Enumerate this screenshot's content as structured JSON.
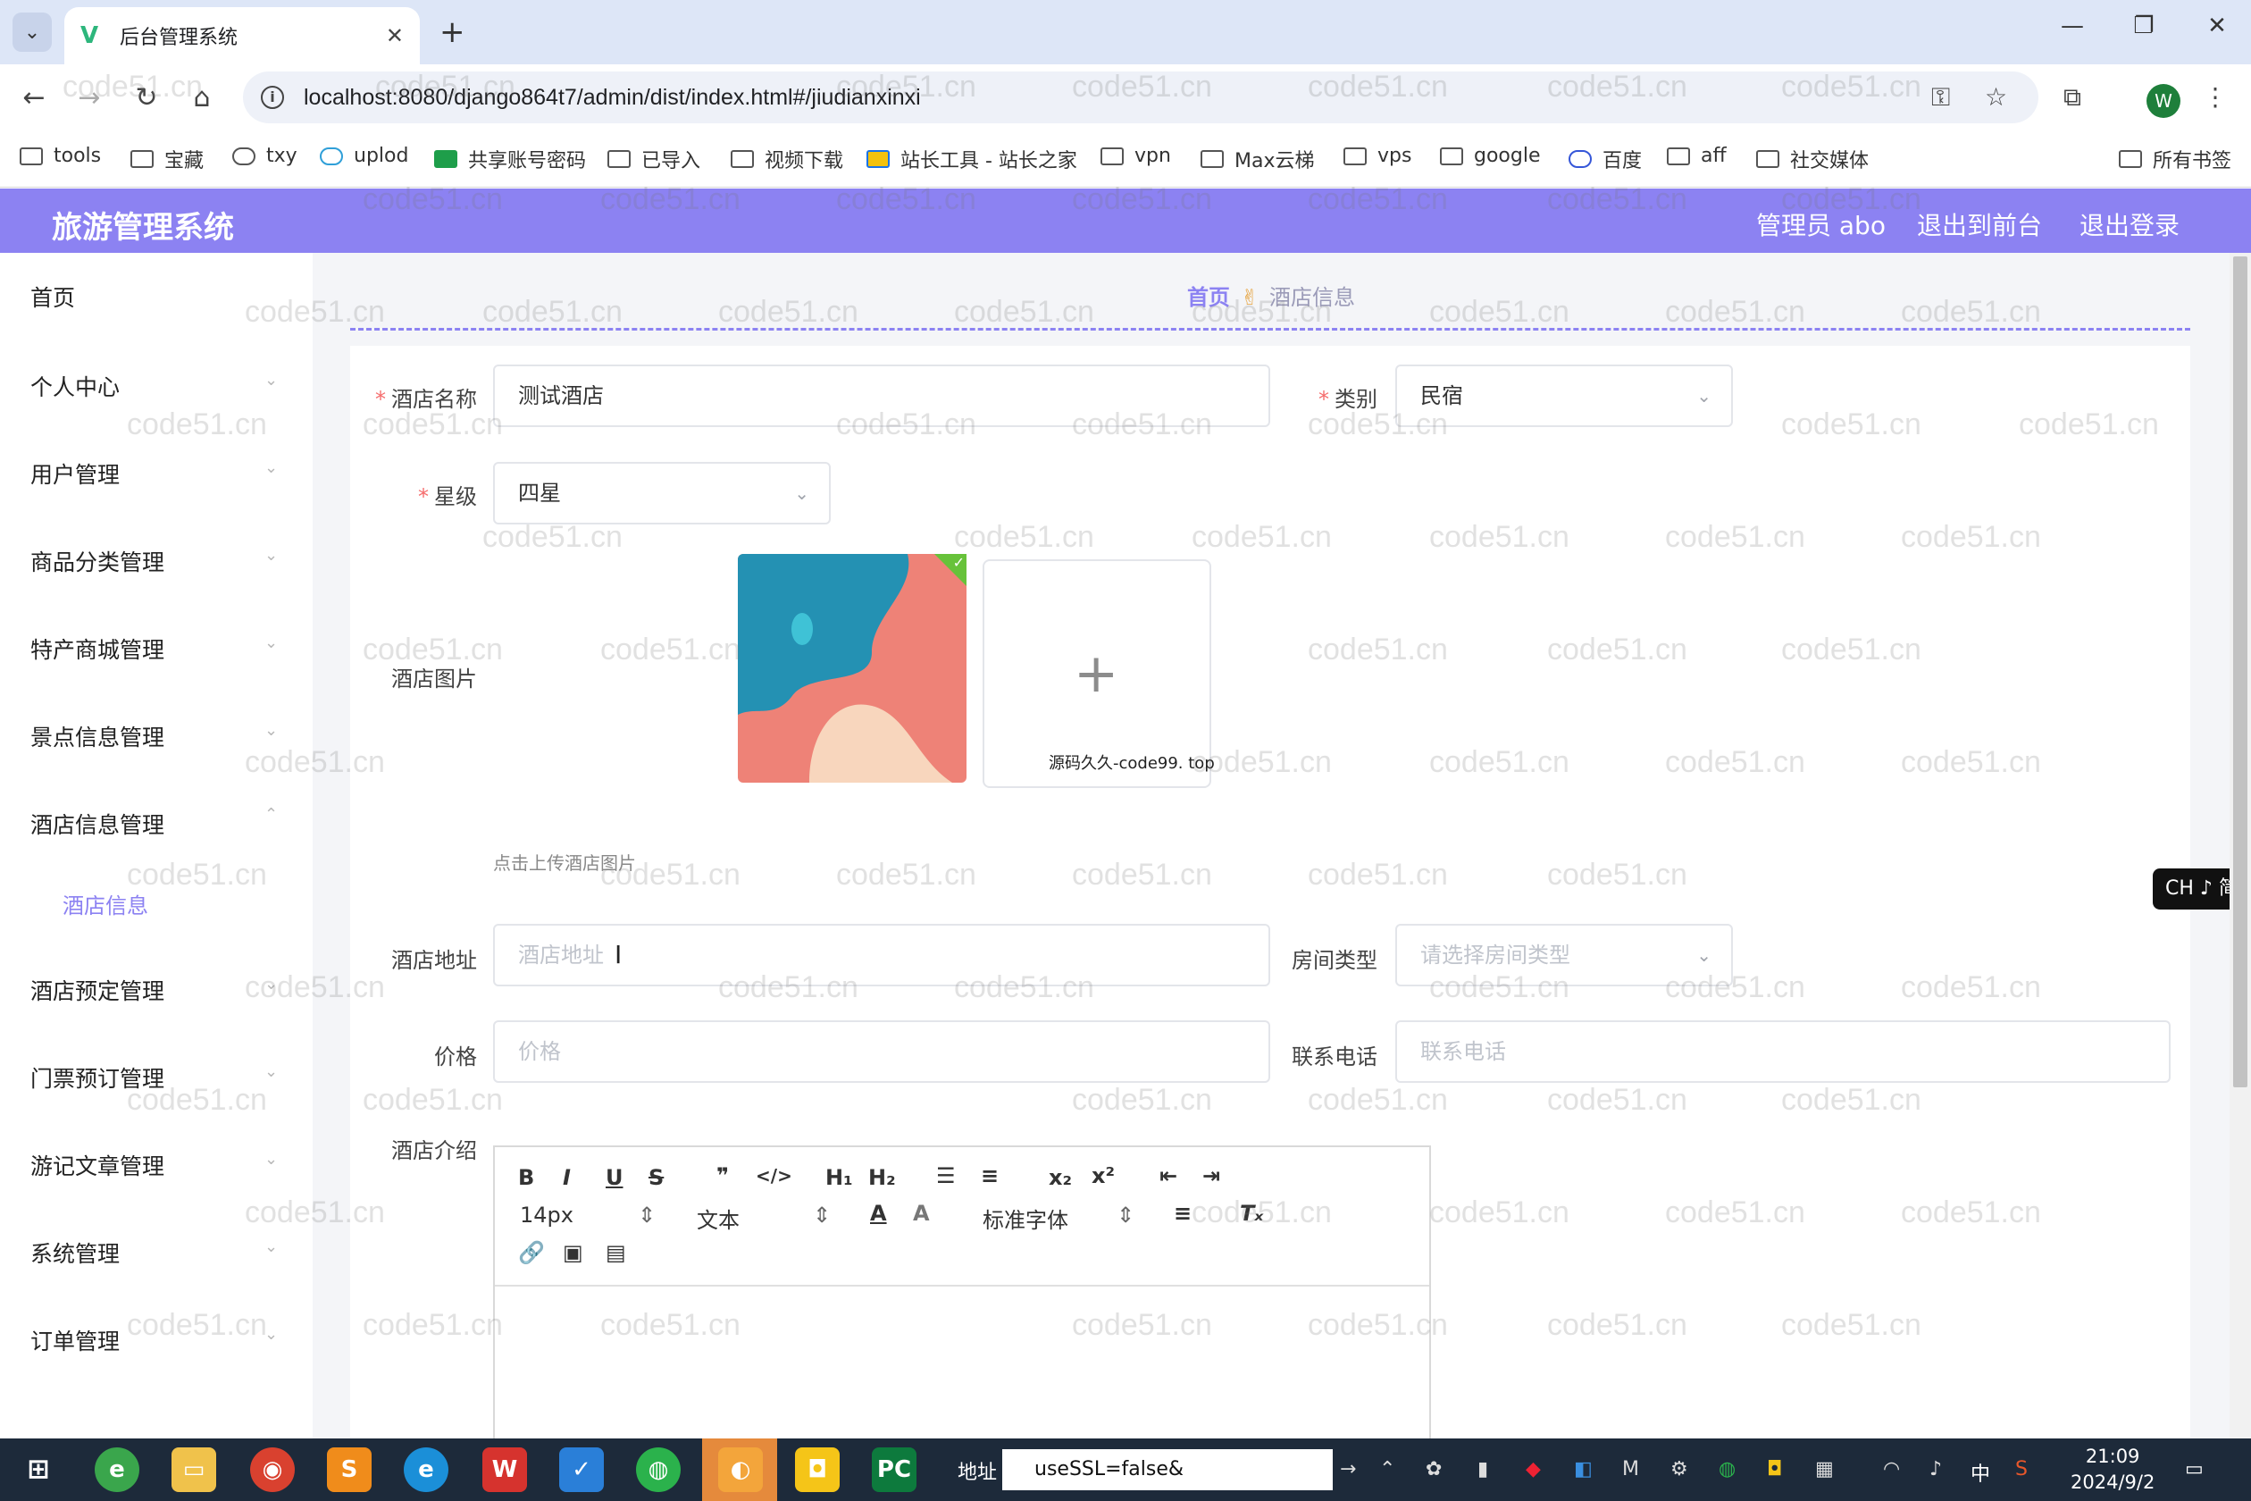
{
  "browser": {
    "tab_title": "后台管理系统",
    "url": "localhost:8080/django864t7/admin/dist/index.html#/jiudianxinxi",
    "bookmarks": [
      "tools",
      "宝藏",
      "txy",
      "uplod",
      "共享账号密码",
      "已导入",
      "视频下载",
      "站长工具 - 站长之家",
      "vpn",
      "Max云梯",
      "vps",
      "google",
      "百度",
      "aff",
      "社交媒体",
      "所有书签"
    ],
    "profile_initial": "W"
  },
  "header": {
    "brand": "旅游管理系统",
    "user": "管理员 abo",
    "to_front": "退出到前台",
    "logout": "退出登录"
  },
  "sidebar": {
    "items": [
      "首页",
      "个人中心",
      "用户管理",
      "商品分类管理",
      "特产商城管理",
      "景点信息管理",
      "酒店信息管理",
      "酒店预定管理",
      "门票预订管理",
      "游记文章管理",
      "系统管理",
      "订单管理"
    ],
    "sub_active": "酒店信息"
  },
  "breadcrumb": {
    "home": "首页",
    "current": "酒店信息"
  },
  "form": {
    "name_label": "酒店名称",
    "name_value": "测试酒店",
    "category_label": "类别",
    "category_value": "民宿",
    "star_label": "星级",
    "star_value": "四星",
    "image_label": "酒店图片",
    "upload_tip": "点击上传酒店图片",
    "upload_watermark": "源码久久-code99. top",
    "address_label": "酒店地址",
    "address_placeholder": "酒店地址",
    "roomtype_label": "房间类型",
    "roomtype_placeholder": "请选择房间类型",
    "price_label": "价格",
    "price_placeholder": "价格",
    "phone_label": "联系电话",
    "phone_placeholder": "联系电话",
    "intro_label": "酒店介绍"
  },
  "editor": {
    "font_size": "14px",
    "header_select": "文本",
    "font_family": "标准字体"
  },
  "ime_badge": "CH ♪ 简",
  "watermark_text": "code51.cn",
  "taskbar": {
    "address_label": "地址",
    "address_value": "useSSL=false&",
    "time": "21:09",
    "date": "2024/9/2",
    "ime": "中"
  }
}
